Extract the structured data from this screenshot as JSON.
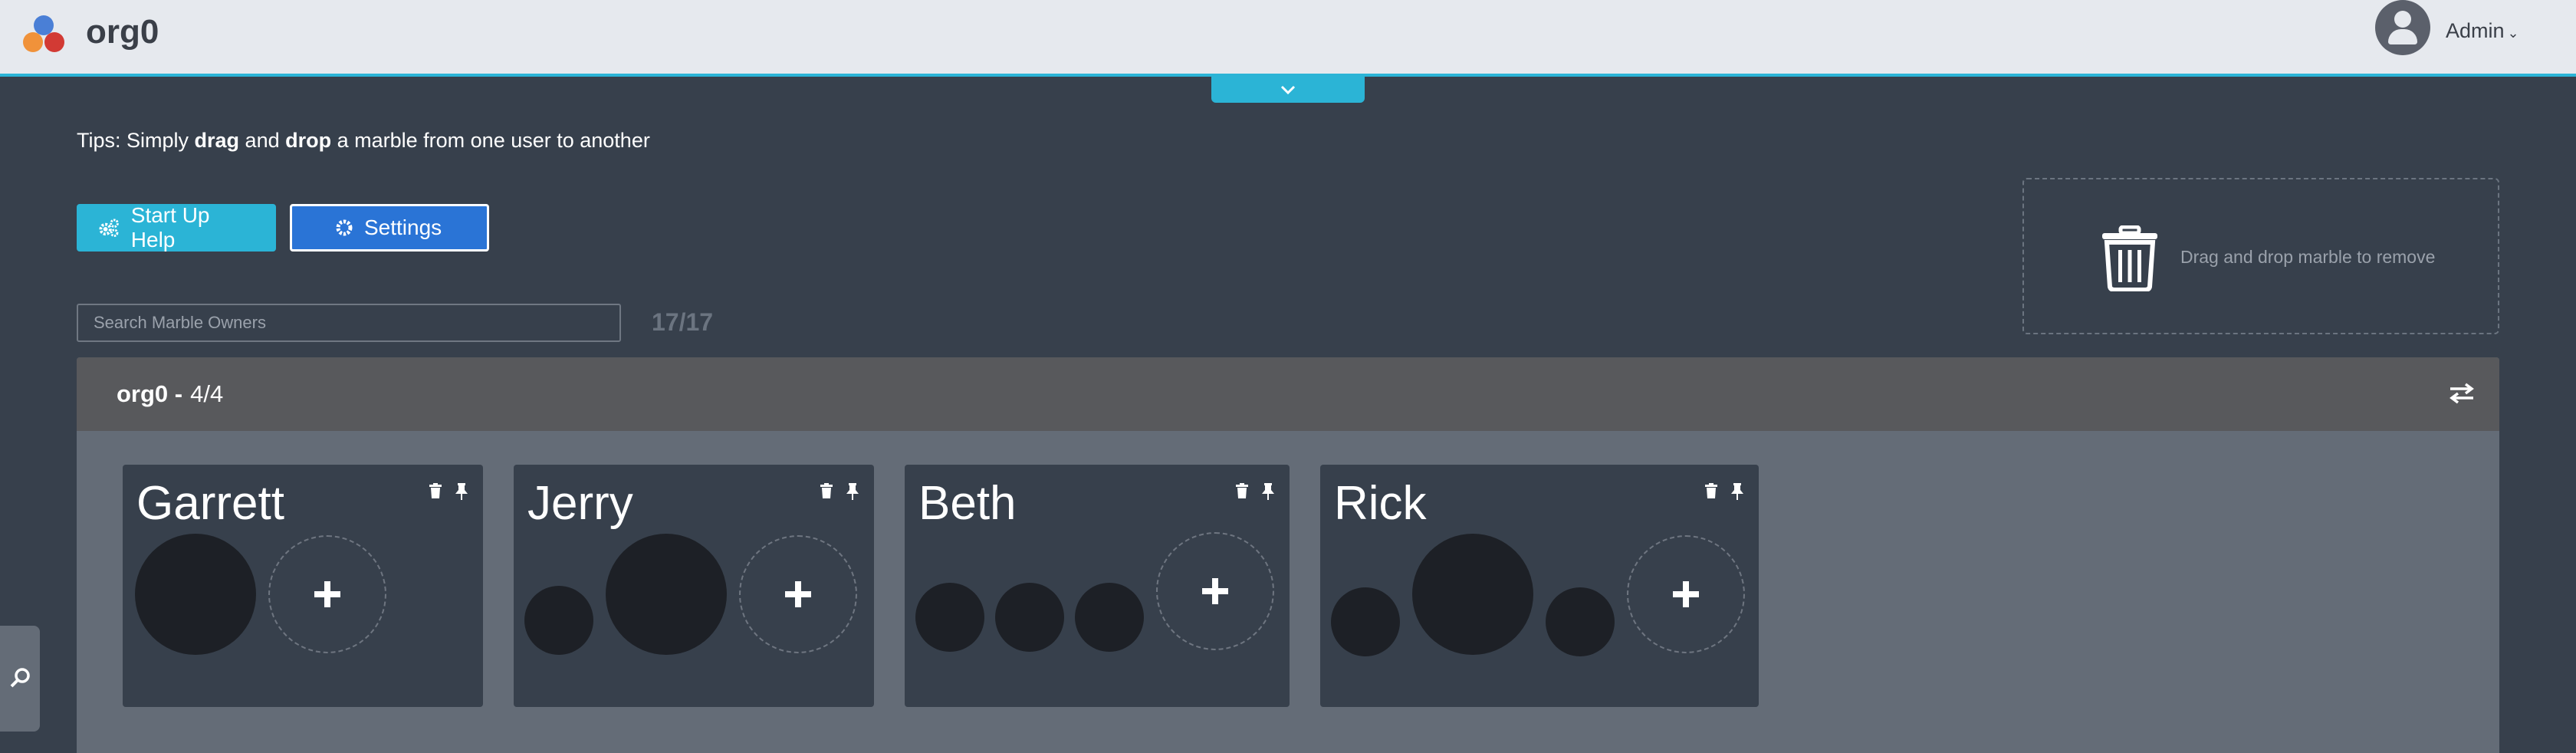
{
  "header": {
    "app_title": "org0",
    "user_label": "Admin",
    "accent_color": "#2bb4d6"
  },
  "tips": {
    "prefix": "Tips: Simply ",
    "drag": "drag",
    "and": " and ",
    "drop": "drop",
    "suffix": " a marble from one user to another"
  },
  "buttons": {
    "start_up_help": "Start Up Help",
    "settings": "Settings"
  },
  "trash_zone": {
    "text": "Drag and drop marble to remove"
  },
  "search": {
    "placeholder": "Search Marble Owners",
    "value": ""
  },
  "owner_count": "17/17",
  "org": {
    "name": "org0 -",
    "count": "4/4",
    "users": [
      {
        "name": "Garrett",
        "marble_count": 1
      },
      {
        "name": "Jerry",
        "marble_count": 2
      },
      {
        "name": "Beth",
        "marble_count": 3
      },
      {
        "name": "Rick",
        "marble_count": 3
      }
    ]
  },
  "icons": {
    "logo": "marbles-logo-icon",
    "user": "user-avatar-icon",
    "expand": "chevron-down-icon",
    "help": "gears-icon",
    "settings": "gear-icon",
    "trash": "trash-icon",
    "swap": "swap-arrows-icon",
    "pin": "pin-icon",
    "add": "plus-icon",
    "search": "search-icon"
  }
}
